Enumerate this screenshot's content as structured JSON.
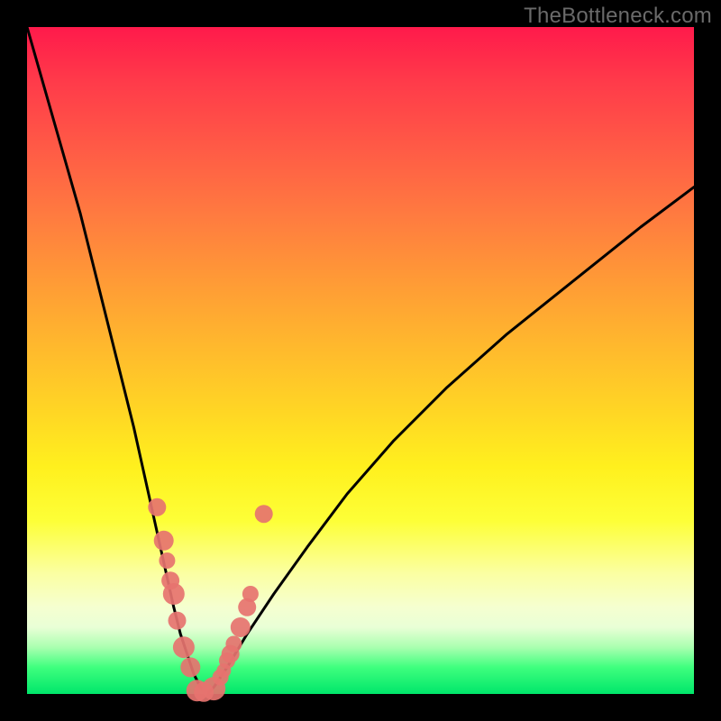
{
  "watermark": "TheBottleneck.com",
  "colors": {
    "curve": "#000000",
    "marker_fill": "#e6736f",
    "marker_stroke": "#d85e5a",
    "frame": "#000000"
  },
  "chart_data": {
    "type": "line",
    "title": "",
    "xlabel": "",
    "ylabel": "",
    "xlim": [
      0,
      100
    ],
    "ylim": [
      0,
      100
    ],
    "grid": false,
    "legend": false,
    "series": [
      {
        "name": "bottleneck-curve",
        "x": [
          0,
          2,
          4,
          6,
          8,
          10,
          12,
          14,
          16,
          18,
          20,
          22,
          23,
          24,
          25,
          26,
          27,
          28,
          30,
          33,
          37,
          42,
          48,
          55,
          63,
          72,
          82,
          92,
          100
        ],
        "values": [
          100,
          93,
          86,
          79,
          72,
          64,
          56,
          48,
          40,
          31,
          22,
          13,
          9,
          6,
          3,
          1,
          0,
          1,
          4,
          9,
          15,
          22,
          30,
          38,
          46,
          54,
          62,
          70,
          76
        ]
      }
    ],
    "markers": {
      "name": "highlighted-points",
      "x": [
        19.5,
        20.5,
        21.0,
        21.5,
        22.0,
        22.5,
        23.5,
        24.5,
        25.5,
        26.5,
        28.0,
        29.0,
        29.5,
        30.0,
        30.5,
        31.0,
        32.0,
        33.0,
        33.5,
        35.5
      ],
      "y": [
        28.0,
        23.0,
        20.0,
        17.0,
        15.0,
        11.0,
        7.0,
        4.0,
        0.5,
        0.3,
        0.8,
        2.5,
        3.5,
        5.0,
        6.0,
        7.5,
        10.0,
        13.0,
        15.0,
        27.0
      ],
      "r": [
        10,
        11,
        9,
        10,
        12,
        10,
        12,
        11,
        12,
        11,
        13,
        9,
        8,
        9,
        10,
        9,
        11,
        10,
        9,
        10
      ]
    }
  }
}
